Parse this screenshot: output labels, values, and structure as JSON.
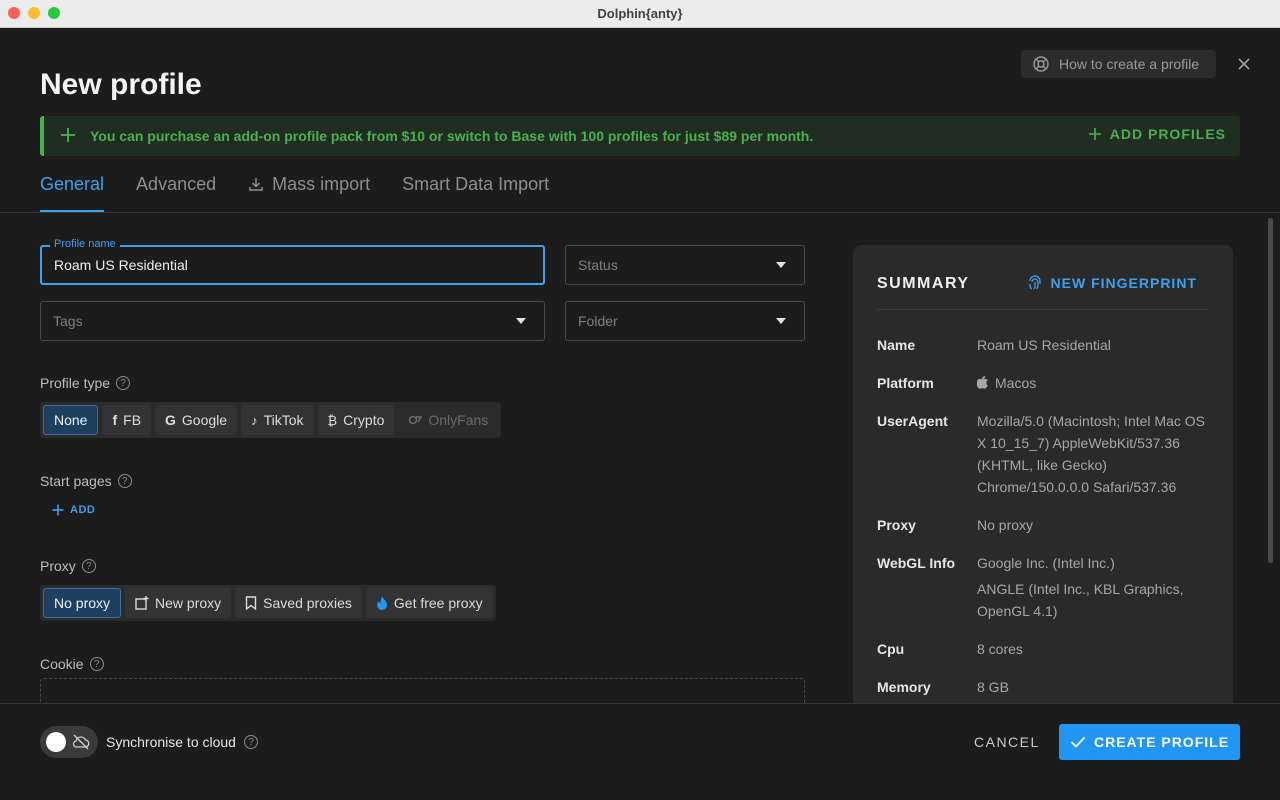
{
  "window": {
    "title": "Dolphin{anty}"
  },
  "header": {
    "title": "New profile",
    "help_label": "How to create a profile"
  },
  "banner": {
    "message": "You can purchase an add-on profile pack from $10 or switch to Base with 100 profiles for just $89 per month.",
    "action_label": "ADD PROFILES"
  },
  "tabs": [
    {
      "label": "General"
    },
    {
      "label": "Advanced"
    },
    {
      "label": "Mass import"
    },
    {
      "label": "Smart Data Import"
    }
  ],
  "form": {
    "profile_name_label": "Profile name",
    "profile_name_value": "Roam US Residential",
    "status_placeholder": "Status",
    "tags_placeholder": "Tags",
    "folder_placeholder": "Folder",
    "profile_type_label": "Profile type",
    "profile_types": [
      {
        "label": "None"
      },
      {
        "label": "FB"
      },
      {
        "label": "Google"
      },
      {
        "label": "TikTok"
      },
      {
        "label": "Crypto"
      },
      {
        "label": "OnlyFans"
      }
    ],
    "start_pages_label": "Start pages",
    "start_pages_add": "ADD",
    "proxy_label": "Proxy",
    "proxy_options": [
      {
        "label": "No proxy"
      },
      {
        "label": "New proxy"
      },
      {
        "label": "Saved proxies"
      },
      {
        "label": "Get free proxy"
      }
    ],
    "cookie_label": "Cookie"
  },
  "summary": {
    "title": "SUMMARY",
    "new_fingerprint_label": "NEW FINGERPRINT",
    "rows": [
      {
        "key": "Name",
        "value": "Roam US Residential"
      },
      {
        "key": "Platform",
        "value": "Macos"
      },
      {
        "key": "UserAgent",
        "value": "Mozilla/5.0 (Macintosh; Intel Mac OS X 10_15_7) AppleWebKit/537.36 (KHTML, like Gecko) Chrome/150.0.0.0 Safari/537.36"
      },
      {
        "key": "Proxy",
        "value": "No proxy"
      },
      {
        "key": "WebGL Info",
        "value": "Google Inc. (Intel Inc.)",
        "value2": "ANGLE (Intel Inc., KBL Graphics, OpenGL 4.1)"
      },
      {
        "key": "Cpu",
        "value": "8 cores"
      },
      {
        "key": "Memory",
        "value": "8 GB"
      }
    ]
  },
  "footer": {
    "sync_label": "Synchronise to cloud",
    "cancel_label": "CANCEL",
    "create_label": "CREATE PROFILE"
  },
  "colors": {
    "accent": "#2196f3",
    "success": "#4caf50",
    "background": "#1c1c1c"
  }
}
